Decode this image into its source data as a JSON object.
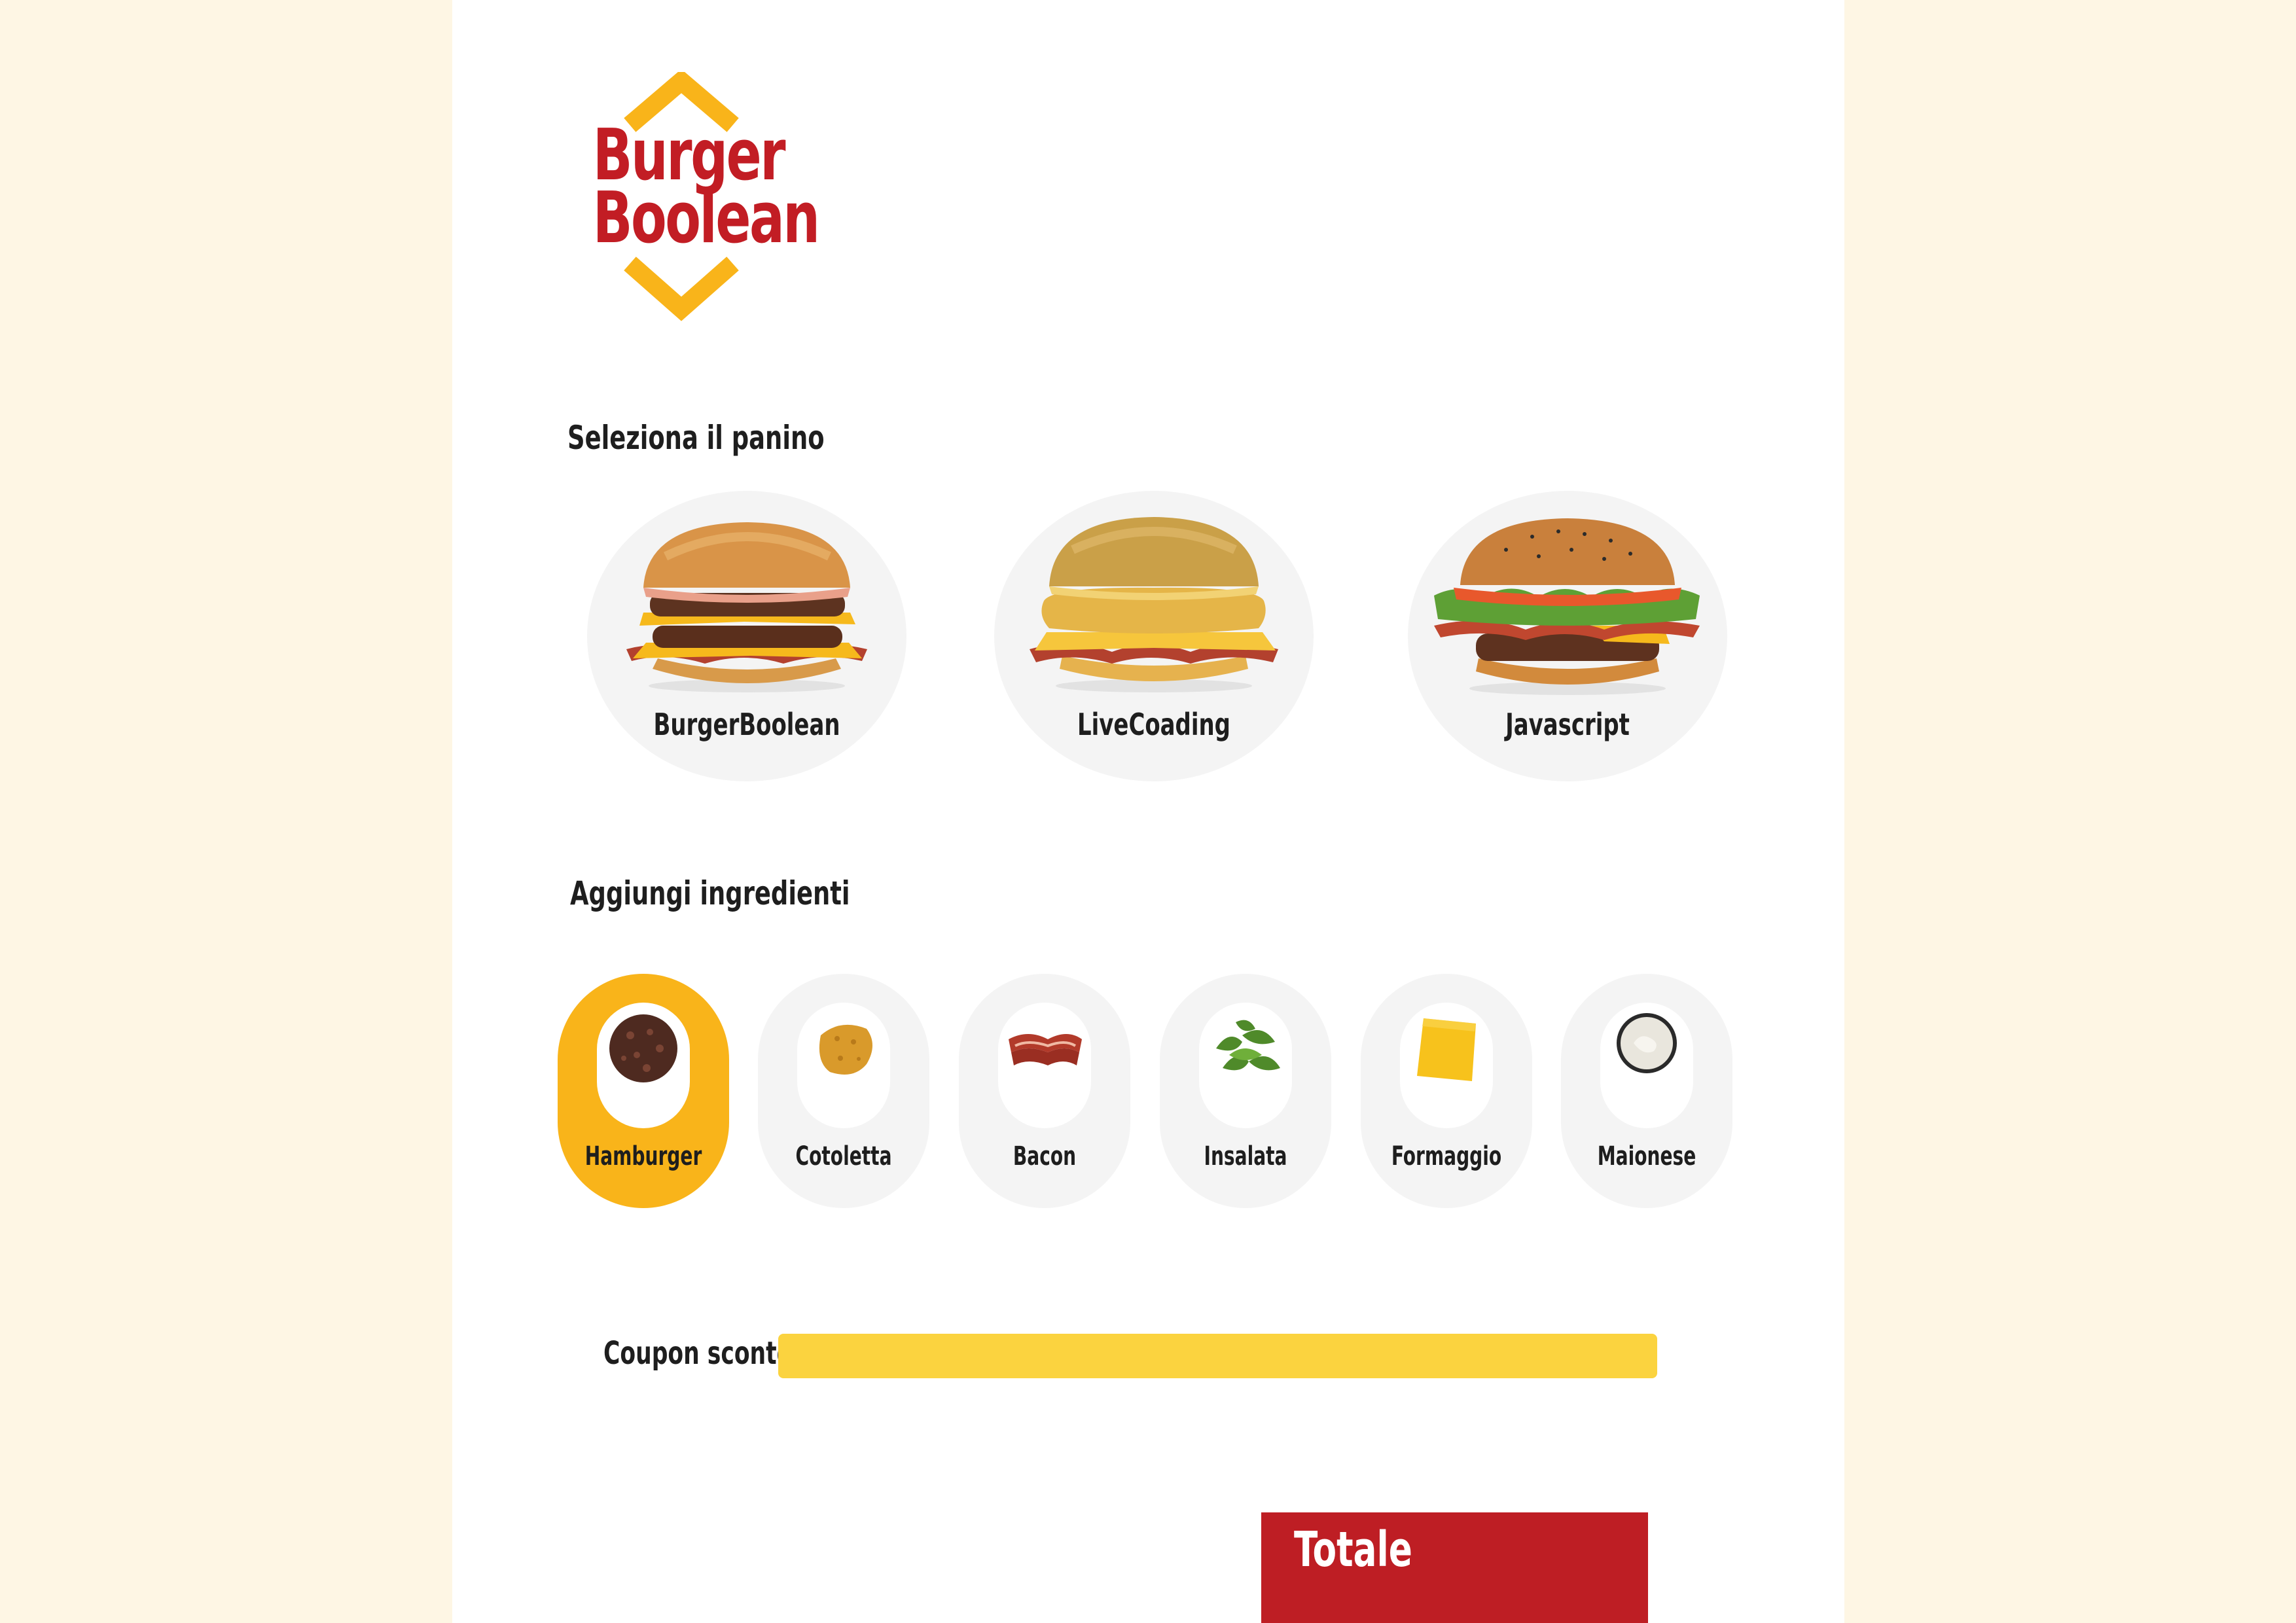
{
  "brand": {
    "line1": "Burger",
    "line2": "Boolean",
    "red": "#c21d24",
    "yellow": "#f9b41a"
  },
  "panini_section": {
    "title": "Seleziona il panino",
    "items": [
      {
        "label": "BurgerBoolean",
        "icon": "double-cheeseburger-bacon-image"
      },
      {
        "label": "LiveCoading",
        "icon": "chicken-burger-bacon-image"
      },
      {
        "label": "Javascript",
        "icon": "burger-salad-sauce-image"
      }
    ]
  },
  "ingredienti_section": {
    "title": "Aggiungi ingredienti",
    "items": [
      {
        "label": "Hamburger",
        "icon": "hamburger-patty-icon",
        "selected": true
      },
      {
        "label": "Cotoletta",
        "icon": "cotoletta-icon",
        "selected": false
      },
      {
        "label": "Bacon",
        "icon": "bacon-icon",
        "selected": false
      },
      {
        "label": "Insalata",
        "icon": "insalata-icon",
        "selected": false
      },
      {
        "label": "Formaggio",
        "icon": "formaggio-icon",
        "selected": false
      },
      {
        "label": "Maionese",
        "icon": "maionese-icon",
        "selected": false
      }
    ]
  },
  "coupon": {
    "label": "Coupon sconto",
    "value": "",
    "color": "#fbd33f"
  },
  "totale": {
    "label": "Totale",
    "color": "#be1e24"
  }
}
